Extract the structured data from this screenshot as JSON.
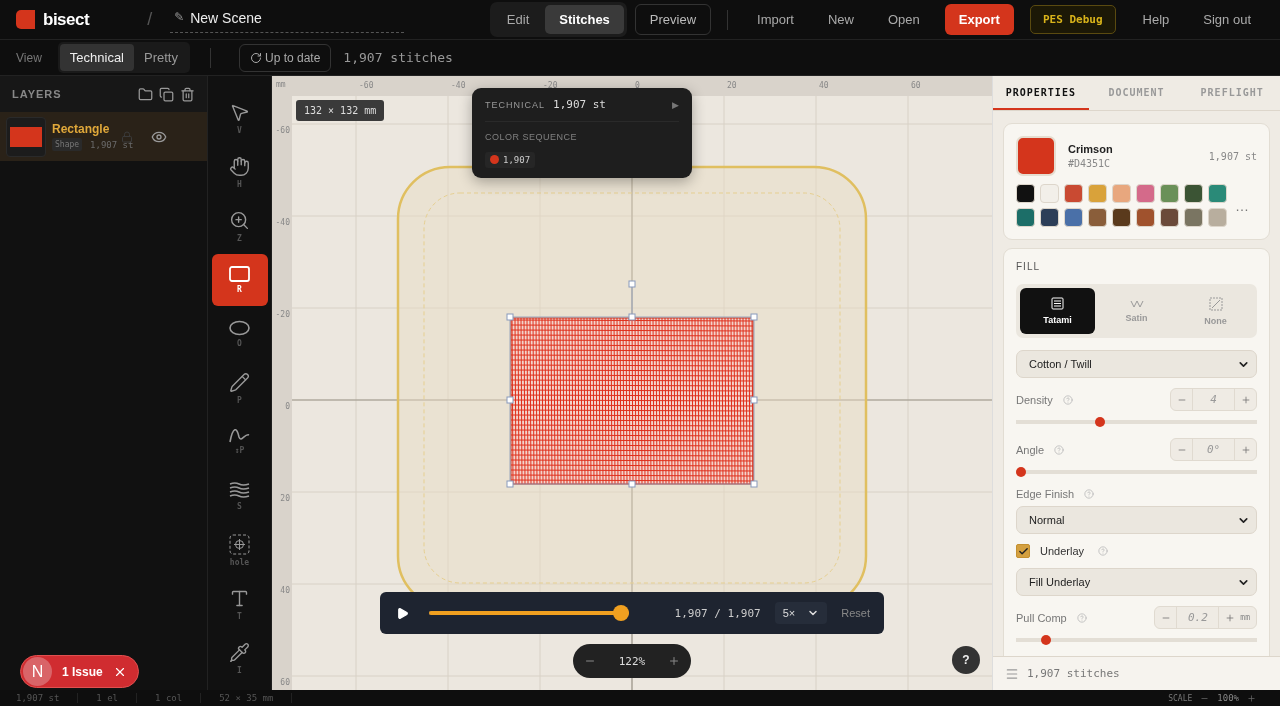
{
  "app": {
    "logo_text": "bisect",
    "separator": "/",
    "scene_icon": "✎",
    "scene_title": "New Scene"
  },
  "mode_tabs": [
    {
      "label": "Edit",
      "selected": false
    },
    {
      "label": "Stitches",
      "selected": true
    }
  ],
  "preview_button": "Preview",
  "menu": [
    "Import",
    "New",
    "Open"
  ],
  "export_button": "Export",
  "debug_button": "PES Debug",
  "account_links": [
    "Help",
    "Sign out"
  ],
  "view_bar": {
    "label": "View",
    "views": [
      {
        "label": "Technical",
        "selected": true
      },
      {
        "label": "Pretty",
        "selected": false
      }
    ],
    "status_button": "Up to date",
    "stitch_count": "1,907 stitches"
  },
  "layers": {
    "title": "LAYERS",
    "items": [
      {
        "name": "Rectangle",
        "type": "Shape",
        "stitches": "1,907 st",
        "color": "#d4351c",
        "selected": true,
        "locked": false,
        "visible": true
      }
    ]
  },
  "tools": [
    {
      "kind": "select",
      "key": "V",
      "selected": false
    },
    {
      "kind": "hand",
      "key": "H",
      "selected": false
    },
    {
      "kind": "zoom",
      "key": "Z",
      "selected": false
    },
    {
      "kind": "rect",
      "key": "R",
      "selected": true
    },
    {
      "kind": "ellipse",
      "key": "O",
      "selected": false
    },
    {
      "kind": "pen",
      "key": "P",
      "selected": false
    },
    {
      "kind": "curve",
      "key": "↕P",
      "selected": false
    },
    {
      "kind": "satin",
      "key": "S",
      "selected": false
    },
    {
      "kind": "hole",
      "key": "hole",
      "selected": false
    },
    {
      "kind": "text",
      "key": "T",
      "selected": false
    },
    {
      "kind": "eyedropper",
      "key": "I",
      "selected": false
    }
  ],
  "canvas": {
    "ruler_unit": "mm",
    "x_ticks": [
      "-60",
      "-40",
      "-20",
      "0",
      "20",
      "40",
      "60"
    ],
    "y_ticks": [
      "-60",
      "-40",
      "-20",
      "0",
      "20",
      "40",
      "60"
    ],
    "size_badge": "132 × 132 mm",
    "info_popover": {
      "title": "TECHNICAL",
      "count": "1,907 st",
      "arrow": "▶",
      "sequence_label": "COLOR SEQUENCE",
      "sequence": [
        {
          "color": "#d4351c",
          "count": "1,907"
        }
      ]
    },
    "playback": {
      "level": 1,
      "counter": "1,907 / 1,907",
      "speed": "5×",
      "reset": "Reset"
    },
    "zoom": "122%",
    "help": "?"
  },
  "issue_toast": {
    "avatar": "N",
    "label": "1 Issue"
  },
  "properties": {
    "tabs": [
      {
        "label": "PROPERTIES",
        "selected": true
      },
      {
        "label": "DOCUMENT",
        "selected": false
      },
      {
        "label": "PREFLIGHT",
        "selected": false
      }
    ],
    "color": {
      "name": "Crimson",
      "hex": "#D4351C",
      "count": "1,907 st",
      "more": "…",
      "palette": [
        {
          "color": "#111111"
        },
        {
          "color": "#f2efe9"
        },
        {
          "color": "#c94a32"
        },
        {
          "color": "#d9a23a"
        },
        {
          "color": "#e8a77e"
        },
        {
          "color": "#d46a8a"
        },
        {
          "color": "#6a9058"
        },
        {
          "color": "#3b5434"
        },
        {
          "color": "#2a8a78"
        },
        {
          "color": "#1c6e68"
        },
        {
          "color": "#2c3e58"
        },
        {
          "color": "#4a70a8"
        },
        {
          "color": "#8a5e3a"
        },
        {
          "color": "#5a3a1c"
        },
        {
          "color": "#a0522d"
        },
        {
          "color": "#6b4a3a"
        },
        {
          "color": "#7a7562"
        },
        {
          "color": "#b8ae9e"
        }
      ]
    },
    "fill": {
      "title": "FILL",
      "types": [
        {
          "kind": "tatami",
          "label": "Tatami",
          "selected": true
        },
        {
          "kind": "satin",
          "label": "Satin",
          "selected": false
        },
        {
          "kind": "none",
          "label": "None",
          "selected": false
        }
      ],
      "material": "Cotton / Twill",
      "controls": [
        {
          "kind": "stepper",
          "label": "Density",
          "value": "4",
          "level": 0.34
        },
        {
          "kind": "stepper",
          "label": "Angle",
          "value": "0°",
          "level": 0
        },
        {
          "kind": "select",
          "label": "Edge Finish",
          "value": "Normal"
        },
        {
          "kind": "checkbox",
          "label": "Underlay",
          "checked": true
        },
        {
          "kind": "select",
          "value": "Fill Underlay"
        },
        {
          "kind": "stepper",
          "label": "Pull Comp",
          "value": "0.2",
          "unit": "mm",
          "level": 0.11
        }
      ]
    },
    "footer": "1,907 stitches"
  },
  "status_bar": {
    "items": [
      "1,907 st",
      "1 el",
      "1 col",
      "52 × 35 mm"
    ],
    "scale_label": "SCALE",
    "scale": "100%"
  }
}
